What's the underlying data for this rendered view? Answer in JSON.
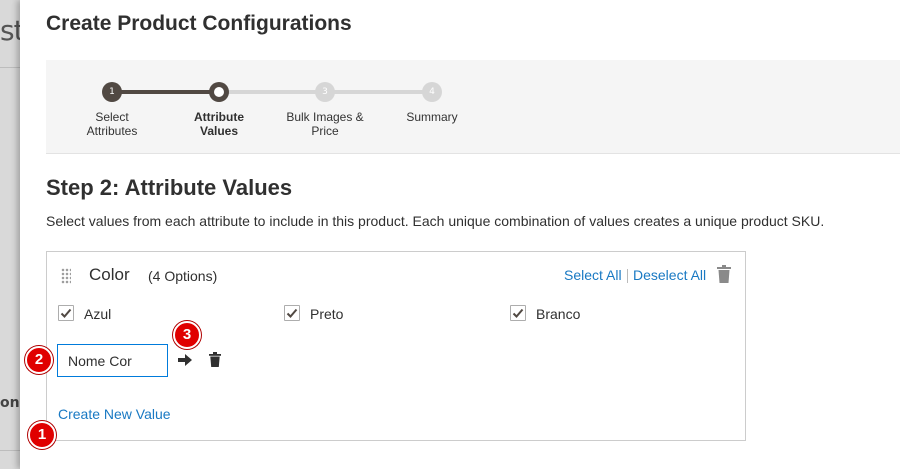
{
  "background": {
    "fragment_top": "st",
    "fragment_bottom": "on"
  },
  "modal": {
    "title": "Create Product Configurations"
  },
  "steps": [
    {
      "number": "1",
      "label": "Select\nAttributes",
      "state": "done"
    },
    {
      "number": "",
      "label": "Attribute\nValues",
      "state": "current"
    },
    {
      "number": "3",
      "label": "Bulk Images &\nPrice",
      "state": "todo"
    },
    {
      "number": "4",
      "label": "Summary",
      "state": "todo"
    }
  ],
  "step_content": {
    "heading": "Step 2: Attribute Values",
    "description": "Select values from each attribute to include in this product. Each unique combination of values creates a unique product SKU."
  },
  "attribute": {
    "name": "Color",
    "count": "(4 Options)",
    "select_all": "Select All",
    "deselect_all": "Deselect All",
    "options": [
      {
        "label": "Azul",
        "checked": true
      },
      {
        "label": "Preto",
        "checked": true
      },
      {
        "label": "Branco",
        "checked": true
      }
    ],
    "new_value": "Nome Cor",
    "create_new": "Create New Value"
  },
  "callouts": [
    "1",
    "2",
    "3"
  ],
  "colors": {
    "accent_link": "#1979c3",
    "step_done": "#514943",
    "step_todo": "#d6d6d6",
    "input_focus": "#007bdb",
    "callout": "#e00000"
  }
}
